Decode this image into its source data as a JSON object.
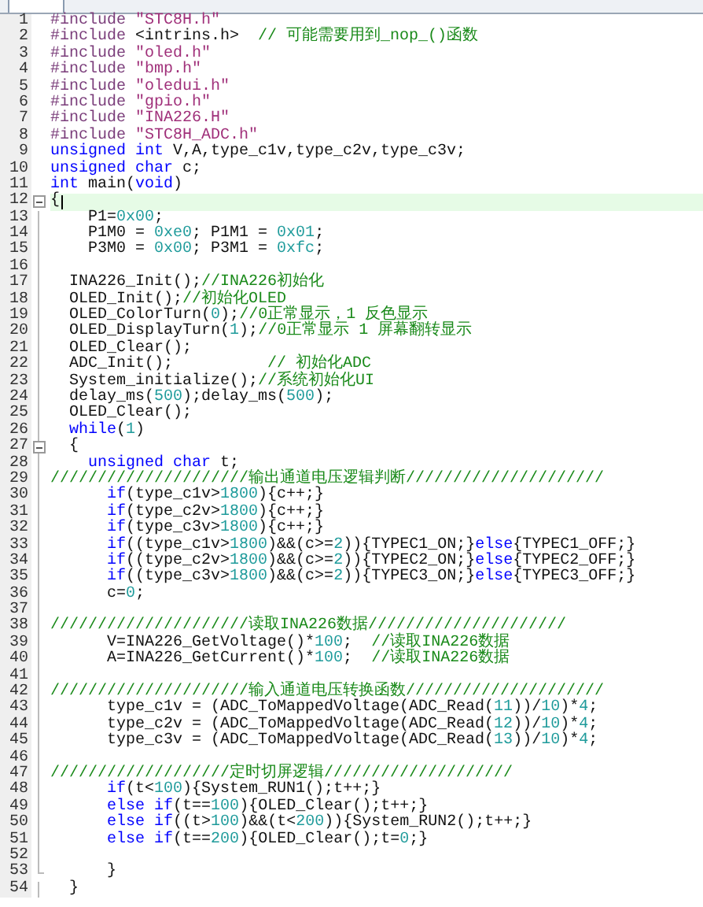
{
  "editor": {
    "tab": {
      "selected": true
    },
    "lines": [
      {
        "number": "1",
        "current": false,
        "kind": "code",
        "tokens": [
          {
            "kind": "directive",
            "text": "#include"
          },
          {
            "kind": "string",
            "text": " \"STC8H.h\""
          }
        ]
      },
      {
        "number": "2",
        "current": false,
        "kind": "code",
        "tokens": [
          {
            "kind": "directive",
            "text": "#include"
          },
          {
            "kind": "plain",
            "text": " <intrins.h>  "
          },
          {
            "kind": "comment",
            "text": "// 可能需要用到_nop_()函数"
          }
        ]
      },
      {
        "number": "3",
        "current": false,
        "kind": "code",
        "tokens": [
          {
            "kind": "directive",
            "text": "#include"
          },
          {
            "kind": "string",
            "text": " \"oled.h\""
          }
        ]
      },
      {
        "number": "4",
        "current": false,
        "kind": "code",
        "tokens": [
          {
            "kind": "directive",
            "text": "#include"
          },
          {
            "kind": "string",
            "text": " \"bmp.h\""
          }
        ]
      },
      {
        "number": "5",
        "current": false,
        "kind": "code",
        "tokens": [
          {
            "kind": "directive",
            "text": "#include"
          },
          {
            "kind": "string",
            "text": " \"oledui.h\""
          }
        ]
      },
      {
        "number": "6",
        "current": false,
        "kind": "code",
        "tokens": [
          {
            "kind": "directive",
            "text": "#include"
          },
          {
            "kind": "string",
            "text": " \"gpio.h\""
          }
        ]
      },
      {
        "number": "7",
        "current": false,
        "kind": "code",
        "tokens": [
          {
            "kind": "directive",
            "text": "#include"
          },
          {
            "kind": "string",
            "text": " \"INA226.H\""
          }
        ]
      },
      {
        "number": "8",
        "current": false,
        "kind": "code",
        "tokens": [
          {
            "kind": "directive",
            "text": "#include"
          },
          {
            "kind": "string",
            "text": " \"STC8H_ADC.h\""
          }
        ]
      },
      {
        "number": "9",
        "current": false,
        "kind": "code",
        "tokens": [
          {
            "kind": "keyword",
            "text": "unsigned "
          },
          {
            "kind": "keyword",
            "text": "int"
          },
          {
            "kind": "plain",
            "text": " V,A,type_c1v,type_c2v,type_c3v;"
          }
        ]
      },
      {
        "number": "10",
        "current": false,
        "kind": "code",
        "tokens": [
          {
            "kind": "keyword",
            "text": "unsigned "
          },
          {
            "kind": "keyword",
            "text": "char"
          },
          {
            "kind": "plain",
            "text": " c;"
          }
        ]
      },
      {
        "number": "11",
        "current": false,
        "kind": "code",
        "tokens": [
          {
            "kind": "keyword",
            "text": "int"
          },
          {
            "kind": "plain",
            "text": " main("
          },
          {
            "kind": "keyword",
            "text": "void"
          },
          {
            "kind": "plain",
            "text": ")"
          }
        ]
      },
      {
        "number": "12",
        "current": true,
        "kind": "fold_start",
        "tokens": [
          {
            "kind": "plain",
            "text": "{"
          }
        ]
      },
      {
        "number": "13",
        "current": false,
        "kind": "code",
        "tokens": [
          {
            "kind": "plain",
            "text": "    P1="
          },
          {
            "kind": "number",
            "text": "0x00"
          },
          {
            "kind": "plain",
            "text": ";"
          }
        ]
      },
      {
        "number": "14",
        "current": false,
        "kind": "code",
        "tokens": [
          {
            "kind": "plain",
            "text": "    P1M0 = "
          },
          {
            "kind": "number",
            "text": "0xe0"
          },
          {
            "kind": "plain",
            "text": "; P1M1 = "
          },
          {
            "kind": "number",
            "text": "0x01"
          },
          {
            "kind": "plain",
            "text": ";"
          }
        ]
      },
      {
        "number": "15",
        "current": false,
        "kind": "code",
        "tokens": [
          {
            "kind": "plain",
            "text": "    P3M0 = "
          },
          {
            "kind": "number",
            "text": "0x00"
          },
          {
            "kind": "plain",
            "text": "; P3M1 = "
          },
          {
            "kind": "number",
            "text": "0xfc"
          },
          {
            "kind": "plain",
            "text": ";"
          }
        ]
      },
      {
        "number": "16",
        "current": false,
        "kind": "code"
      },
      {
        "number": "17",
        "current": false,
        "kind": "code",
        "tokens": [
          {
            "kind": "plain",
            "text": "  INA226_Init();"
          },
          {
            "kind": "comment",
            "text": "//INA226初始化"
          }
        ]
      },
      {
        "number": "18",
        "current": false,
        "kind": "code",
        "tokens": [
          {
            "kind": "plain",
            "text": "  OLED_Init();"
          },
          {
            "kind": "comment",
            "text": "//初始化OLED"
          }
        ]
      },
      {
        "number": "19",
        "current": false,
        "kind": "code",
        "tokens": [
          {
            "kind": "plain",
            "text": "  OLED_ColorTurn("
          },
          {
            "kind": "number",
            "text": "0"
          },
          {
            "kind": "plain",
            "text": ");"
          },
          {
            "kind": "comment",
            "text": "//0正常显示，1 反色显示"
          }
        ]
      },
      {
        "number": "20",
        "current": false,
        "kind": "code",
        "tokens": [
          {
            "kind": "plain",
            "text": "  OLED_DisplayTurn("
          },
          {
            "kind": "number",
            "text": "1"
          },
          {
            "kind": "plain",
            "text": ");"
          },
          {
            "kind": "comment",
            "text": "//0正常显示 1 屏幕翻转显示"
          }
        ]
      },
      {
        "number": "21",
        "current": false,
        "kind": "code",
        "tokens": [
          {
            "kind": "plain",
            "text": "  OLED_Clear();"
          }
        ]
      },
      {
        "number": "22",
        "current": false,
        "kind": "code",
        "tokens": [
          {
            "kind": "plain",
            "text": "  ADC_Init();          "
          },
          {
            "kind": "comment",
            "text": "// 初始化ADC"
          }
        ]
      },
      {
        "number": "23",
        "current": false,
        "kind": "code",
        "tokens": [
          {
            "kind": "plain",
            "text": "  System_initialize();"
          },
          {
            "kind": "comment",
            "text": "//系统初始化UI"
          }
        ]
      },
      {
        "number": "24",
        "current": false,
        "kind": "code",
        "tokens": [
          {
            "kind": "plain",
            "text": "  delay_ms("
          },
          {
            "kind": "number",
            "text": "500"
          },
          {
            "kind": "plain",
            "text": ");delay_ms("
          },
          {
            "kind": "number",
            "text": "500"
          },
          {
            "kind": "plain",
            "text": ");"
          }
        ]
      },
      {
        "number": "25",
        "current": false,
        "kind": "code",
        "tokens": [
          {
            "kind": "plain",
            "text": "  OLED_Clear();"
          }
        ]
      },
      {
        "number": "26",
        "current": false,
        "kind": "code",
        "tokens": [
          {
            "kind": "keyword",
            "text": "  while"
          },
          {
            "kind": "plain",
            "text": "("
          },
          {
            "kind": "number",
            "text": "1"
          },
          {
            "kind": "plain",
            "text": ")"
          }
        ]
      },
      {
        "number": "27",
        "current": false,
        "kind": "fold_start",
        "tokens": [
          {
            "kind": "plain",
            "text": "  {"
          }
        ]
      },
      {
        "number": "28",
        "current": false,
        "kind": "code",
        "tokens": [
          {
            "kind": "keyword",
            "text": "    unsigned "
          },
          {
            "kind": "keyword",
            "text": "char"
          },
          {
            "kind": "plain",
            "text": " t;"
          }
        ]
      },
      {
        "number": "29",
        "current": false,
        "kind": "code",
        "tokens": [
          {
            "kind": "comment",
            "text": "/////////////////////输出通道电压逻辑判断/////////////////////"
          }
        ]
      },
      {
        "number": "30",
        "current": false,
        "kind": "code",
        "tokens": [
          {
            "kind": "keyword",
            "text": "      if"
          },
          {
            "kind": "plain",
            "text": "(type_c1v>"
          },
          {
            "kind": "number",
            "text": "1800"
          },
          {
            "kind": "plain",
            "text": "){c++;}"
          }
        ]
      },
      {
        "number": "31",
        "current": false,
        "kind": "code",
        "tokens": [
          {
            "kind": "keyword",
            "text": "      if"
          },
          {
            "kind": "plain",
            "text": "(type_c2v>"
          },
          {
            "kind": "number",
            "text": "1800"
          },
          {
            "kind": "plain",
            "text": "){c++;}"
          }
        ]
      },
      {
        "number": "32",
        "current": false,
        "kind": "code",
        "tokens": [
          {
            "kind": "keyword",
            "text": "      if"
          },
          {
            "kind": "plain",
            "text": "(type_c3v>"
          },
          {
            "kind": "number",
            "text": "1800"
          },
          {
            "kind": "plain",
            "text": "){c++;}"
          }
        ]
      },
      {
        "number": "33",
        "current": false,
        "kind": "code",
        "tokens": [
          {
            "kind": "keyword",
            "text": "      if"
          },
          {
            "kind": "plain",
            "text": "((type_c1v>"
          },
          {
            "kind": "number",
            "text": "1800"
          },
          {
            "kind": "plain",
            "text": ")&&(c>="
          },
          {
            "kind": "number",
            "text": "2"
          },
          {
            "kind": "plain",
            "text": ")){TYPEC1_ON;}"
          },
          {
            "kind": "keyword",
            "text": "else"
          },
          {
            "kind": "plain",
            "text": "{TYPEC1_OFF;}"
          }
        ]
      },
      {
        "number": "34",
        "current": false,
        "kind": "code",
        "tokens": [
          {
            "kind": "keyword",
            "text": "      if"
          },
          {
            "kind": "plain",
            "text": "((type_c2v>"
          },
          {
            "kind": "number",
            "text": "1800"
          },
          {
            "kind": "plain",
            "text": ")&&(c>="
          },
          {
            "kind": "number",
            "text": "2"
          },
          {
            "kind": "plain",
            "text": ")){TYPEC2_ON;}"
          },
          {
            "kind": "keyword",
            "text": "else"
          },
          {
            "kind": "plain",
            "text": "{TYPEC2_OFF;}"
          }
        ]
      },
      {
        "number": "35",
        "current": false,
        "kind": "code",
        "tokens": [
          {
            "kind": "keyword",
            "text": "      if"
          },
          {
            "kind": "plain",
            "text": "((type_c3v>"
          },
          {
            "kind": "number",
            "text": "1800"
          },
          {
            "kind": "plain",
            "text": ")&&(c>="
          },
          {
            "kind": "number",
            "text": "2"
          },
          {
            "kind": "plain",
            "text": ")){TYPEC3_ON;}"
          },
          {
            "kind": "keyword",
            "text": "else"
          },
          {
            "kind": "plain",
            "text": "{TYPEC3_OFF;}"
          }
        ]
      },
      {
        "number": "36",
        "current": false,
        "kind": "code",
        "tokens": [
          {
            "kind": "plain",
            "text": "      c="
          },
          {
            "kind": "number",
            "text": "0"
          },
          {
            "kind": "plain",
            "text": ";"
          }
        ]
      },
      {
        "number": "37",
        "current": false,
        "kind": "code"
      },
      {
        "number": "38",
        "current": false,
        "kind": "code",
        "tokens": [
          {
            "kind": "comment",
            "text": "/////////////////////读取INA226数据/////////////////////"
          }
        ]
      },
      {
        "number": "39",
        "current": false,
        "kind": "code",
        "tokens": [
          {
            "kind": "plain",
            "text": "      V=INA226_GetVoltage()*"
          },
          {
            "kind": "number",
            "text": "100"
          },
          {
            "kind": "plain",
            "text": ";  "
          },
          {
            "kind": "comment",
            "text": "//读取INA226数据"
          }
        ]
      },
      {
        "number": "40",
        "current": false,
        "kind": "code",
        "tokens": [
          {
            "kind": "plain",
            "text": "      A=INA226_GetCurrent()*"
          },
          {
            "kind": "number",
            "text": "100"
          },
          {
            "kind": "plain",
            "text": ";  "
          },
          {
            "kind": "comment",
            "text": "//读取INA226数据"
          }
        ]
      },
      {
        "number": "41",
        "current": false,
        "kind": "code"
      },
      {
        "number": "42",
        "current": false,
        "kind": "code",
        "tokens": [
          {
            "kind": "comment",
            "text": "/////////////////////输入通道电压转换函数/////////////////////"
          }
        ]
      },
      {
        "number": "43",
        "current": false,
        "kind": "code",
        "tokens": [
          {
            "kind": "plain",
            "text": "      type_c1v = (ADC_ToMappedVoltage(ADC_Read("
          },
          {
            "kind": "number",
            "text": "11"
          },
          {
            "kind": "plain",
            "text": "))/"
          },
          {
            "kind": "number",
            "text": "10"
          },
          {
            "kind": "plain",
            "text": ")*"
          },
          {
            "kind": "number",
            "text": "4"
          },
          {
            "kind": "plain",
            "text": ";"
          }
        ]
      },
      {
        "number": "44",
        "current": false,
        "kind": "code",
        "tokens": [
          {
            "kind": "plain",
            "text": "      type_c2v = (ADC_ToMappedVoltage(ADC_Read("
          },
          {
            "kind": "number",
            "text": "12"
          },
          {
            "kind": "plain",
            "text": "))/"
          },
          {
            "kind": "number",
            "text": "10"
          },
          {
            "kind": "plain",
            "text": ")*"
          },
          {
            "kind": "number",
            "text": "4"
          },
          {
            "kind": "plain",
            "text": ";"
          }
        ]
      },
      {
        "number": "45",
        "current": false,
        "kind": "code",
        "tokens": [
          {
            "kind": "plain",
            "text": "      type_c3v = (ADC_ToMappedVoltage(ADC_Read("
          },
          {
            "kind": "number",
            "text": "13"
          },
          {
            "kind": "plain",
            "text": "))/"
          },
          {
            "kind": "number",
            "text": "10"
          },
          {
            "kind": "plain",
            "text": ")*"
          },
          {
            "kind": "number",
            "text": "4"
          },
          {
            "kind": "plain",
            "text": ";"
          }
        ]
      },
      {
        "number": "46",
        "current": false,
        "kind": "code"
      },
      {
        "number": "47",
        "current": false,
        "kind": "code",
        "tokens": [
          {
            "kind": "comment",
            "text": "///////////////////定时切屏逻辑////////////////////"
          }
        ]
      },
      {
        "number": "48",
        "current": false,
        "kind": "code",
        "tokens": [
          {
            "kind": "keyword",
            "text": "      if"
          },
          {
            "kind": "plain",
            "text": "(t<"
          },
          {
            "kind": "number",
            "text": "100"
          },
          {
            "kind": "plain",
            "text": "){System_RUN1();t++;}"
          }
        ]
      },
      {
        "number": "49",
        "current": false,
        "kind": "code",
        "tokens": [
          {
            "kind": "keyword",
            "text": "      else "
          },
          {
            "kind": "keyword",
            "text": "if"
          },
          {
            "kind": "plain",
            "text": "(t=="
          },
          {
            "kind": "number",
            "text": "100"
          },
          {
            "kind": "plain",
            "text": "){OLED_Clear();t++;}"
          }
        ]
      },
      {
        "number": "50",
        "current": false,
        "kind": "code",
        "tokens": [
          {
            "kind": "keyword",
            "text": "      else "
          },
          {
            "kind": "keyword",
            "text": "if"
          },
          {
            "kind": "plain",
            "text": "((t>"
          },
          {
            "kind": "number",
            "text": "100"
          },
          {
            "kind": "plain",
            "text": ")&&(t<"
          },
          {
            "kind": "number",
            "text": "200"
          },
          {
            "kind": "plain",
            "text": ")){System_RUN2();t++;}"
          }
        ]
      },
      {
        "number": "51",
        "current": false,
        "kind": "code",
        "tokens": [
          {
            "kind": "keyword",
            "text": "      else "
          },
          {
            "kind": "keyword",
            "text": "if"
          },
          {
            "kind": "plain",
            "text": "(t=="
          },
          {
            "kind": "number",
            "text": "200"
          },
          {
            "kind": "plain",
            "text": "){OLED_Clear();t="
          },
          {
            "kind": "number",
            "text": "0"
          },
          {
            "kind": "plain",
            "text": ";}"
          }
        ]
      },
      {
        "number": "52",
        "current": false,
        "kind": "code"
      },
      {
        "number": "53",
        "current": false,
        "kind": "fold_end",
        "tokens": [
          {
            "kind": "plain",
            "text": "      }"
          }
        ]
      },
      {
        "number": "54",
        "current": false,
        "kind": "code",
        "tokens": [
          {
            "kind": "plain",
            "text": "  }"
          }
        ]
      }
    ]
  }
}
